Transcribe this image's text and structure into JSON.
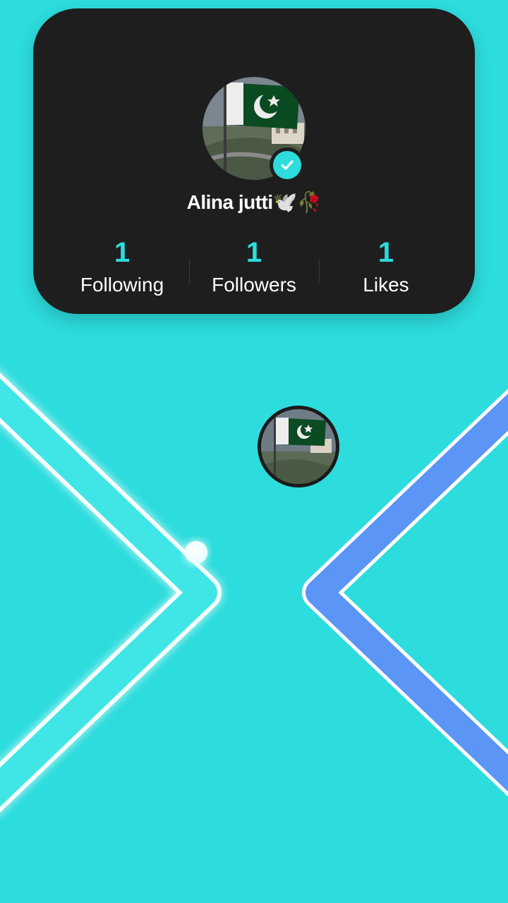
{
  "profile": {
    "name": "Alina jutti🕊️🥀",
    "verified": true,
    "avatar_icon": "pakistan-flag-avatar"
  },
  "stats": [
    {
      "value": "1",
      "label": "Following"
    },
    {
      "value": "1",
      "label": "Followers"
    },
    {
      "value": "1",
      "label": "Likes"
    }
  ],
  "colors": {
    "background": "#2DDCDD",
    "card": "#1E1E1E",
    "accent": "#2DDCDD",
    "left_chevron": "#3FE6E6",
    "right_chevron": "#5B95F5"
  }
}
